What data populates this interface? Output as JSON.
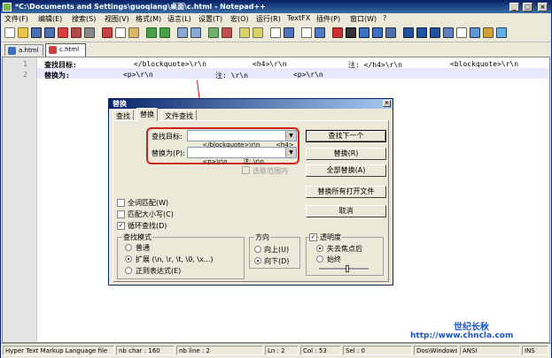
{
  "window": {
    "title": "*C:\\Documents and Settings\\guoqiang\\桌面\\c.html - Notepad++",
    "minimize": "_",
    "maximize": "□",
    "close": "×"
  },
  "menu": [
    "文件(F)",
    "编辑(E)",
    "搜索(S)",
    "视图(V)",
    "格式(M)",
    "语言(L)",
    "设置(T)",
    "宏(O)",
    "运行(R)",
    "TextFX",
    "插件(P)",
    "窗口(W)",
    "?"
  ],
  "tabs": [
    "a.html",
    "c.html"
  ],
  "editor": {
    "line_numbers": [
      "1",
      "2"
    ],
    "line1": {
      "label": "查找目标:",
      "segments": [
        "</blockquote>\\r\\n",
        "<h4>\\r\\n",
        "注: </h4>\\r\\n",
        "<blockquote>\\r\\n"
      ]
    },
    "line2": {
      "label": "替换为:",
      "segments": [
        "<p>\\r\\n",
        "注: \\r\\n",
        "<p>\\r\\n"
      ]
    }
  },
  "dialog": {
    "title": "替换",
    "close": "×",
    "tabs": [
      "查找",
      "替换",
      "文件查找"
    ],
    "find_label": "查找目标:",
    "find_value": "</blockquote>\\r\\n        <h4>",
    "replace_label": "替换为(P):",
    "replace_value": "<p>\\r\\n        注: \\r\\n",
    "in_selection": "选取范围内",
    "buttons": {
      "find_next": "查找下一个",
      "replace": "替换(R)",
      "replace_all": "全部替换(A)",
      "replace_all_open": "替换所有打开文件",
      "cancel": "取消"
    },
    "options": {
      "whole_word": "全词匹配(W)",
      "match_case": "匹配大小写(C)",
      "wrap_around": "循环查找(D)",
      "wrap_checkmark": "✓"
    },
    "search_mode": {
      "title": "查找模式",
      "normal": "普通",
      "extended": "扩展 (\\n, \\r, \\t, \\0, \\x...)",
      "regex": "正则表达式(E)"
    },
    "direction": {
      "title": "方向",
      "up": "向上(U)",
      "down": "向下(D)"
    },
    "transparency": {
      "title": "透明度",
      "checkmark": "✓",
      "on_lose_focus": "失去焦点后",
      "always": "始终"
    }
  },
  "status": {
    "language": "Hyper Text Markup Language file",
    "nb_char": "nb char : 160",
    "nb_line": "nb line : 2",
    "ln": "Ln : 2",
    "col": "Col : 53",
    "sel": "Sel : 0",
    "eol": "Dos\\Windows",
    "encoding": "ANSI",
    "mode": "INS"
  },
  "watermark": {
    "line1": "世纪长秋",
    "line2": "http://www.chncla.com"
  },
  "colors": {
    "title_bar": "#0a246a",
    "highlight_red": "#d02020",
    "watermark_blue": "#1a56c4"
  }
}
